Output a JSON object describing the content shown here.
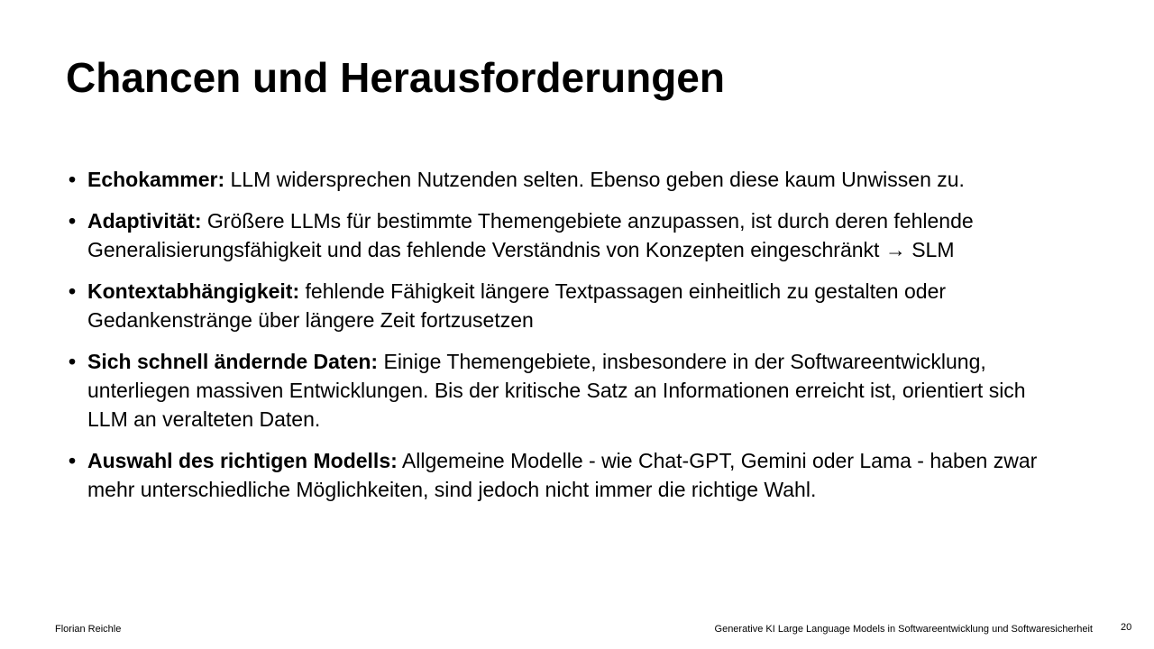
{
  "slide": {
    "title": "Chancen und Herausforderungen",
    "bullet_symbol": "•",
    "bullets": [
      {
        "term": "Echokammer:",
        "text": " LLM widersprechen Nutzenden selten. Ebenso geben diese kaum Unwissen zu."
      },
      {
        "term": "Adaptivität:",
        "text": " Größere LLMs für bestimmte Themengebiete anzupassen, ist durch deren fehlende Generalisierungsfähigkeit und das fehlende Verständnis von Konzepten eingeschränkt → SLM"
      },
      {
        "term": "Kontextabhängigkeit:",
        "text": " fehlende Fähigkeit längere Textpassagen einheitlich zu gestalten oder Gedankenstränge über längere Zeit fortzusetzen"
      },
      {
        "term": "Sich schnell ändernde Daten:",
        "text": " Einige Themengebiete, insbesondere in der Softwareentwicklung, unterliegen massiven Entwicklungen. Bis der kritische Satz an Informationen erreicht ist, orientiert sich LLM an veralteten Daten."
      },
      {
        "term": "Auswahl des richtigen Modells:",
        "text": " Allgemeine Modelle -  wie Chat-GPT, Gemini oder Lama - haben zwar mehr unterschiedliche Möglichkeiten, sind jedoch nicht immer die richtige Wahl."
      }
    ]
  },
  "footer": {
    "author": "Florian Reichle",
    "presentation_title": "Generative KI Large Language Models in Softwareentwicklung und Softwaresicherheit",
    "page_number": "20"
  }
}
